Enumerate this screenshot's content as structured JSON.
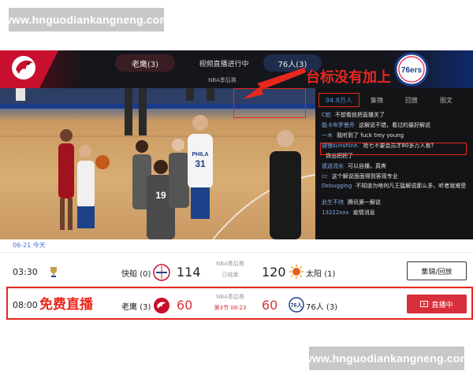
{
  "watermark": {
    "top": "www.hnguodiankangneng.com",
    "bottom": "www.hnguodiankangneng.com"
  },
  "player": {
    "home_team_badge": "老鹰(3)",
    "live_status": "视频直播进行中",
    "away_team_badge": "76人(3)",
    "series_label": "NBA季后赛",
    "sixers_logo_text": "76ers",
    "jersey_numbers": [
      "31",
      "19"
    ],
    "court_text": "PHILA"
  },
  "annotation": {
    "logo_note": "台标没有加上"
  },
  "chat": {
    "tabs": [
      {
        "label": "94.8万人"
      },
      {
        "label": "集锦"
      },
      {
        "label": "回放"
      },
      {
        "label": "图文"
      }
    ],
    "messages": [
      {
        "user": "C蛇",
        "text": "不想看就把直播关了"
      },
      {
        "user": "能卡布罗曼乔",
        "text": "这解说不错，看过的最好解说"
      },
      {
        "user": "一木",
        "text": "我听到了 fuck trey young"
      },
      {
        "user": "链锂sunshine.",
        "text": "抢七不要会员才80多万人看?"
      },
      {
        "user": "",
        "text": "铁出把把了"
      },
      {
        "user": "遗送流长",
        "text": "可以自播，真爽"
      },
      {
        "user": "cc",
        "text": "这个解说面面得到客观专业"
      },
      {
        "user": "Debugging",
        "text": "不知道为啥何凡王猛解说那么多，听者就难受"
      },
      {
        "user": "此生不待",
        "text": "腾讯第一解说"
      },
      {
        "user": "13222xxx",
        "text": "疫情消息"
      }
    ]
  },
  "schedule": {
    "date": "06-21",
    "day": "今天",
    "games": [
      {
        "time": "03:30",
        "home_name": "快船",
        "home_series": "(0)",
        "home_score": "114",
        "series": "NBA季后赛",
        "status": "已结束",
        "away_score": "120",
        "away_name": "太阳",
        "away_series": "(1)",
        "button": "集锦/回放"
      },
      {
        "time": "08:00",
        "home_name": "老鹰",
        "home_series": "(3)",
        "home_score": "60",
        "series": "NBA季后赛",
        "status": "第3节 08:23",
        "away_score": "60",
        "away_name": "76人",
        "away_series": "(3)",
        "button": "直播中"
      }
    ],
    "free_live_note": "免费直播"
  },
  "colors": {
    "annotation_red": "#e8281e",
    "live_button": "#d8303a",
    "date_blue": "#4a6dd8",
    "viewer_blue": "#4a8fe2"
  },
  "icons": [
    "hawks-logo-icon",
    "sixers-logo-icon",
    "clippers-logo-icon",
    "suns-logo-icon",
    "trophy-icon",
    "play-icon"
  ]
}
